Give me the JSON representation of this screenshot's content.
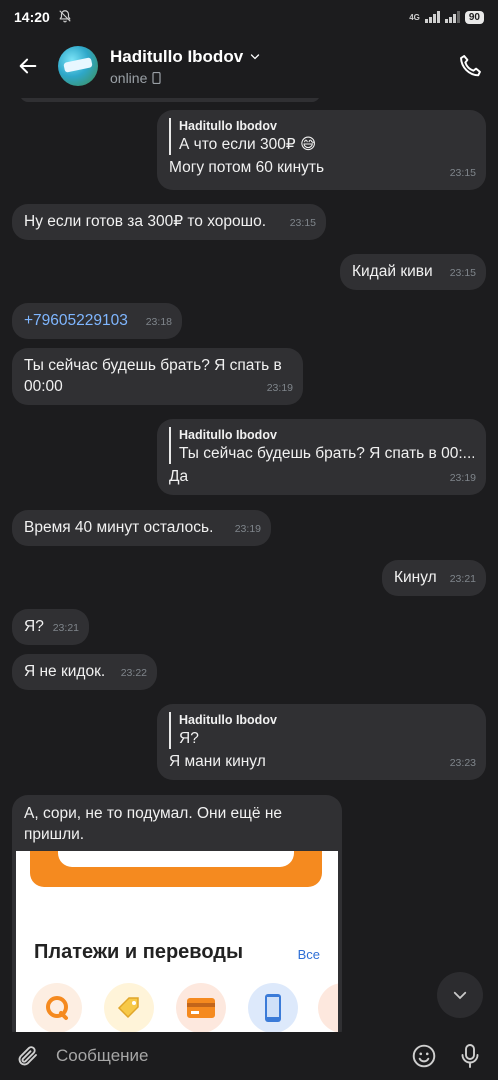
{
  "status_bar": {
    "time": "14:20",
    "network": "4G",
    "battery": "90"
  },
  "header": {
    "name": "Haditullo Ibodov",
    "status": "online"
  },
  "messages": [
    {
      "id": "m1",
      "direction": "out",
      "quote_name": "Haditullo Ibodov",
      "quote_text": "А что если 300₽ 😅",
      "text": "Могу потом 60 кинуть",
      "time": "23:15"
    },
    {
      "id": "m2",
      "direction": "in",
      "text": "Ну если готов за 300₽ то хорошо.",
      "time": "23:15"
    },
    {
      "id": "m3",
      "direction": "out",
      "text": "Кидай киви",
      "time": "23:15"
    },
    {
      "id": "m4",
      "direction": "in",
      "link": "+79605229103",
      "time": "23:18"
    },
    {
      "id": "m5",
      "direction": "in",
      "text_line1": "Ты сейчас будешь брать? Я спать в",
      "text_line2": "00:00",
      "time": "23:19"
    },
    {
      "id": "m6",
      "direction": "out",
      "quote_name": "Haditullo Ibodov",
      "quote_text": "Ты сейчас будешь брать? Я спать в 00:...",
      "text": "Да",
      "time": "23:19"
    },
    {
      "id": "m7",
      "direction": "in",
      "text": "Время 40 минут осталось.",
      "time": "23:19"
    },
    {
      "id": "m8",
      "direction": "out",
      "text": "Кинул",
      "time": "23:21"
    },
    {
      "id": "m9",
      "direction": "in",
      "text": "Я?",
      "time": "23:21"
    },
    {
      "id": "m10",
      "direction": "in",
      "text": "Я не кидок.",
      "time": "23:22"
    },
    {
      "id": "m11",
      "direction": "out",
      "quote_name": "Haditullo Ibodov",
      "quote_text": "Я?",
      "text": "Я мани кинул",
      "time": "23:23"
    },
    {
      "id": "m12",
      "direction": "in",
      "text_line1": "А, сори, не то подумал. Они ещё не",
      "text_line2": "пришли."
    }
  ],
  "embed": {
    "title": "Платежи и переводы",
    "all_link": "Все"
  },
  "input": {
    "placeholder": "Сообщение"
  },
  "colors": {
    "background": "#1c1c1e",
    "bubble": "#303033",
    "link": "#7fb6ff",
    "orange": "#f58a1f"
  }
}
